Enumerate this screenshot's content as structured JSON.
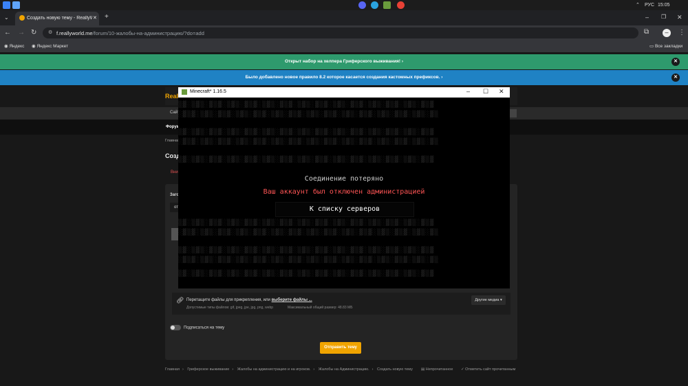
{
  "taskbar": {
    "language": "РУС",
    "time": "15:05"
  },
  "browser": {
    "tab_title": "Создать новую тему - ReallyW",
    "new_tab": "+",
    "url_host": "f.reallyworld.me",
    "url_path": "/forum/10-жалобы-на-администрацию/?do=add",
    "bookmarks": [
      "Яндекс",
      "Яндекс Маркет"
    ],
    "all_bookmarks": "Все закладки"
  },
  "page": {
    "notice1": "Открыт набор на хелпера Гриферского выживания!",
    "notice2": "Было добавлено новое правило 8.2 которое касается создания кастомных префиксов.",
    "header_logo_fragment": "Reall",
    "nav_fragment": "Сайт",
    "sub_fragment": "Форум",
    "crumb_fragment": "Главная",
    "title_fragment": "Созд",
    "warning_fragment": "Вни",
    "field_label_fragment": "Загол",
    "field_value_fragment": "от",
    "drop_text": "Перетащите файлы для прикрепления, или",
    "drop_link": "выберите файлы ...",
    "allowed_types": "Допустимые типы файлов: gif, jpeg, jpe, jpg, png, webp",
    "max_size": "Максимальный общий размер: 48.83 МБ",
    "other_media": "Другие медиа ▾",
    "subscribe": "Подписаться на тему",
    "submit": "Отправить тему",
    "breadcrumbs": [
      "Главная",
      "Гриферское выживание",
      "Жалобы на администрацию и на игроков.",
      "Жалобы на Администрацию.",
      "Создать новую тему"
    ],
    "unread": "Непрочитанное",
    "mark_read": "Отметить сайт прочитанным"
  },
  "minecraft": {
    "window_title": "Minecraft* 1.16.5",
    "connection_lost": "Соединение потеряно",
    "reason": "Ваш аккаунт был отключен администрацией",
    "back_button": "К списку серверов"
  },
  "colors": {
    "notice_green": "#2e9a6d",
    "notice_blue": "#1f82c4",
    "submit_orange": "#f0a400",
    "mc_red": "#ff5555"
  }
}
